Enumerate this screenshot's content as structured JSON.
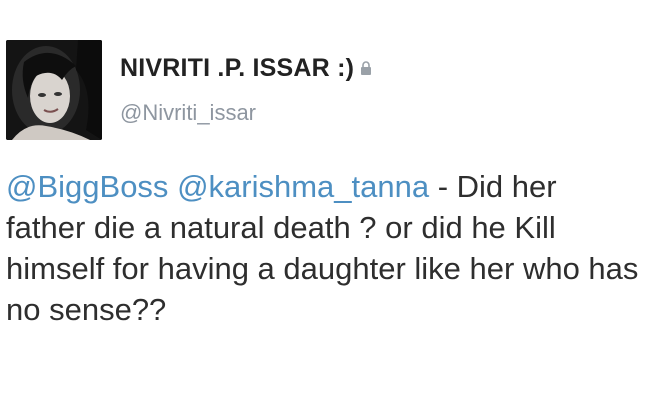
{
  "tweet": {
    "author": {
      "display_name": "NIVRITI .P. ISSAR :)",
      "handle": "@Nivriti_issar",
      "protected_icon": "lock-icon",
      "avatar": "profile-photo"
    },
    "body": {
      "mention_1": "@BiggBoss",
      "separator_1": " ",
      "mention_2": "@karishma_tanna",
      "text": " - Did her father die a natural death ? or did he Kill himself for having a daughter like her who has no sense??"
    },
    "colors": {
      "mention": "#4d8fc2",
      "handle": "#8e96a0",
      "text": "#2e2e2e",
      "background": "#ffffff"
    }
  }
}
